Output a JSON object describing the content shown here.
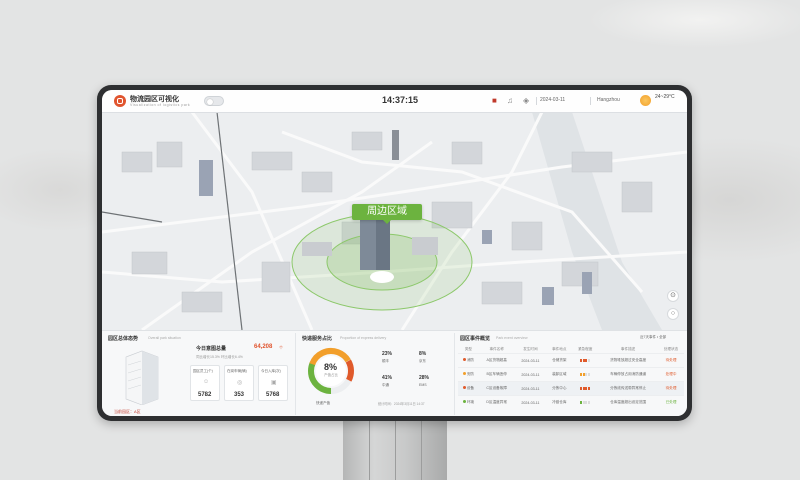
{
  "header": {
    "title": "物流园区可视化",
    "subtitle": "Visualization of logistics park",
    "time": "14:37:15",
    "date": "2024-03-11",
    "location": "Hangzhou",
    "temperature": "24~29°C"
  },
  "map": {
    "label": "周边区域"
  },
  "panels": {
    "park": {
      "title": "园区总体态势",
      "subtitle": "Overall park situation",
      "badge": "当前园区：A区",
      "today_label": "今日意图总量",
      "today_value": "64,208",
      "today_unit": "个",
      "today_note": "同比增长15.3% 环比增长6.4%",
      "stats": [
        {
          "label": "园区员工(个)",
          "value": "5782"
        },
        {
          "label": "在岗车辆(辆)",
          "value": "353"
        },
        {
          "label": "今日入库(次)",
          "value": "5768"
        }
      ]
    },
    "ops": {
      "title": "快递服务占比",
      "subtitle": "Proportion of express delivery",
      "percent": "8%",
      "percent_label": "产值占比",
      "legend": "快递产值",
      "items": [
        {
          "value": "23%",
          "label": "顺丰"
        },
        {
          "value": "8%",
          "label": "京东"
        },
        {
          "value": "41%",
          "label": "中通"
        },
        {
          "value": "28%",
          "label": "EMS"
        }
      ],
      "footer": "统计时间：2024年3月11日 14:37"
    },
    "events": {
      "title": "园区事件概览",
      "subtitle": "Park event overview",
      "filter": "近7天事件 • 全部",
      "columns": [
        "类型",
        "事件名称",
        "发生时间",
        "事件地点",
        "紧急程度",
        "事件描述",
        "处理状态"
      ],
      "rows": [
        [
          "消防",
          "A区货物超高",
          "2024-03-11",
          "仓储货架",
          "",
          "货物堆放超过安全高度",
          "待处理"
        ],
        [
          "安防",
          "B区车辆违停",
          "2024-03-11",
          "装卸区域",
          "",
          "车辆停放占用消防通道",
          "处理中"
        ],
        [
          "设备",
          "C区设备故障",
          "2024-03-11",
          "分拣中心",
          "",
          "分拣线传送带异常停止",
          "待处理"
        ],
        [
          "环境",
          "D区温度异常",
          "2024-03-11",
          "冷链仓库",
          "",
          "仓库温度超出设定范围",
          "已处理"
        ]
      ]
    }
  },
  "colors": {
    "accent_green": "#6cb33f",
    "accent_orange": "#e0542e",
    "alert_red": "#e05a2b"
  }
}
